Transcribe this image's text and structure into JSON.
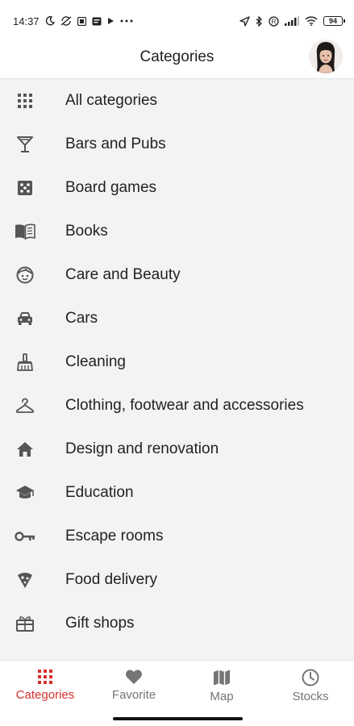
{
  "status_bar": {
    "time": "14:37",
    "battery": "94"
  },
  "header": {
    "title": "Categories"
  },
  "categories": [
    {
      "label": "All categories",
      "icon": "grid-icon"
    },
    {
      "label": "Bars and Pubs",
      "icon": "cocktail-glass-icon"
    },
    {
      "label": "Board games",
      "icon": "dice-icon"
    },
    {
      "label": "Books",
      "icon": "book-icon"
    },
    {
      "label": "Care and Beauty",
      "icon": "face-icon"
    },
    {
      "label": "Cars",
      "icon": "car-icon"
    },
    {
      "label": "Cleaning",
      "icon": "broom-icon"
    },
    {
      "label": "Clothing, footwear and accessories",
      "icon": "hanger-icon"
    },
    {
      "label": "Design and renovation",
      "icon": "house-icon"
    },
    {
      "label": "Education",
      "icon": "graduation-cap-icon"
    },
    {
      "label": "Escape rooms",
      "icon": "key-icon"
    },
    {
      "label": "Food delivery",
      "icon": "pizza-icon"
    },
    {
      "label": "Gift shops",
      "icon": "gift-icon"
    }
  ],
  "bottom_nav": {
    "items": [
      {
        "label": "Categories",
        "icon": "grid-icon",
        "active": true
      },
      {
        "label": "Favorite",
        "icon": "heart-icon",
        "active": false
      },
      {
        "label": "Map",
        "icon": "map-icon",
        "active": false
      },
      {
        "label": "Stocks",
        "icon": "clock-icon",
        "active": false
      }
    ]
  },
  "colors": {
    "accent": "#d32f2f",
    "list_background": "#f3f3f3",
    "icon_gray": "#555555"
  }
}
